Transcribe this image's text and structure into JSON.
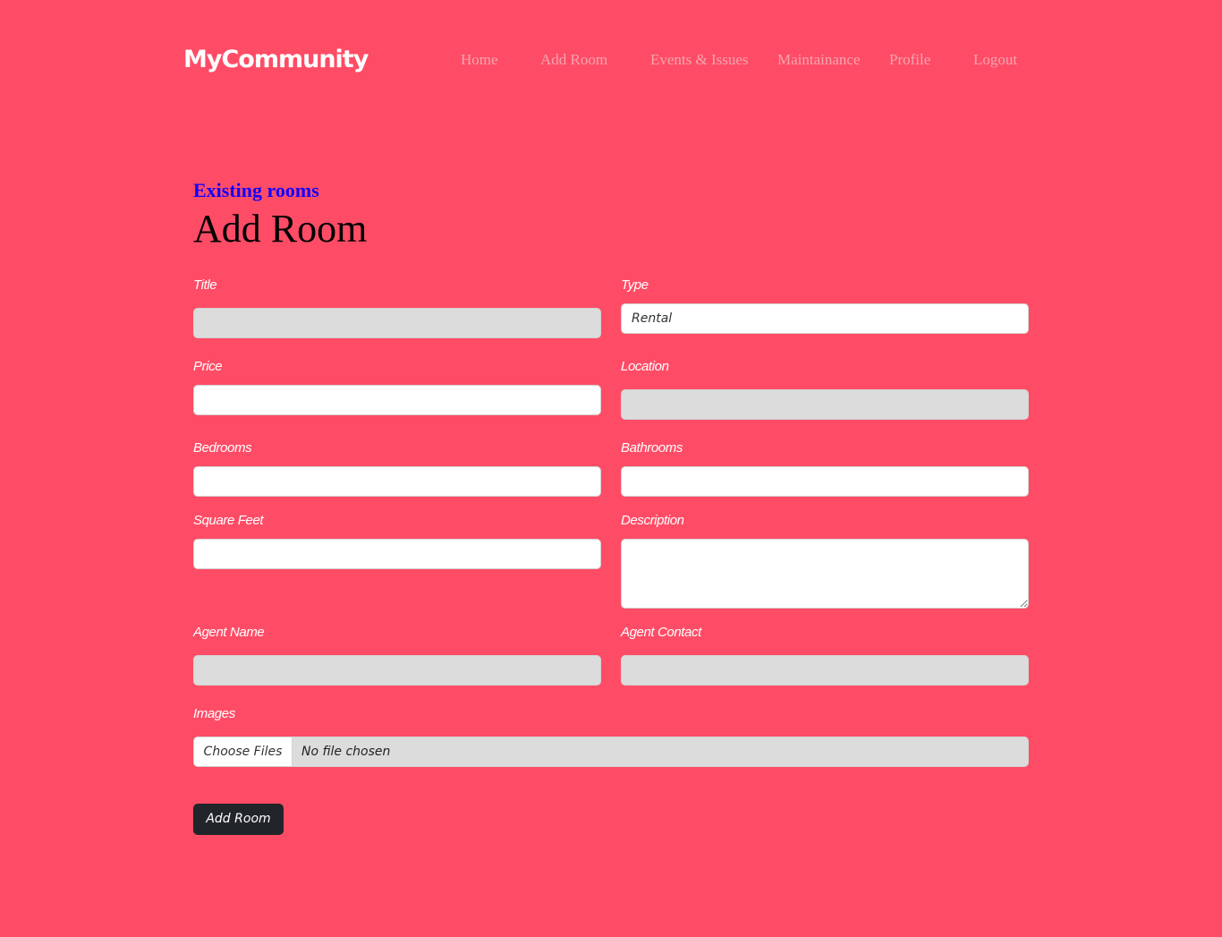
{
  "header": {
    "brand": "MyCommunity",
    "nav": [
      "Home",
      "Add Room",
      "Events & Issues",
      "Maintainance",
      "Profile",
      "Logout"
    ]
  },
  "main": {
    "existing_rooms_link": "Existing rooms",
    "title": "Add Room"
  },
  "form": {
    "title_label": "Title",
    "title_value": "",
    "type_label": "Type",
    "type_value": "Rental",
    "price_label": "Price",
    "price_value": "",
    "location_label": "Location",
    "location_value": "",
    "bedrooms_label": "Bedrooms",
    "bedrooms_value": "",
    "bathrooms_label": "Bathrooms",
    "bathrooms_value": "",
    "square_feet_label": "Square Feet",
    "square_feet_value": "",
    "description_label": "Description",
    "description_value": "",
    "agent_name_label": "Agent Name",
    "agent_name_value": "",
    "agent_contact_label": "Agent Contact",
    "agent_contact_value": "",
    "images_label": "Images",
    "choose_files_label": "Choose Files",
    "file_status": "No file chosen",
    "submit_label": "Add Room"
  },
  "colors": {
    "background": "#ff4c66",
    "nav_text": "#f3a4b0",
    "link": "#1300ff",
    "button": "#212529",
    "disabled_field": "#dcdcdc"
  }
}
